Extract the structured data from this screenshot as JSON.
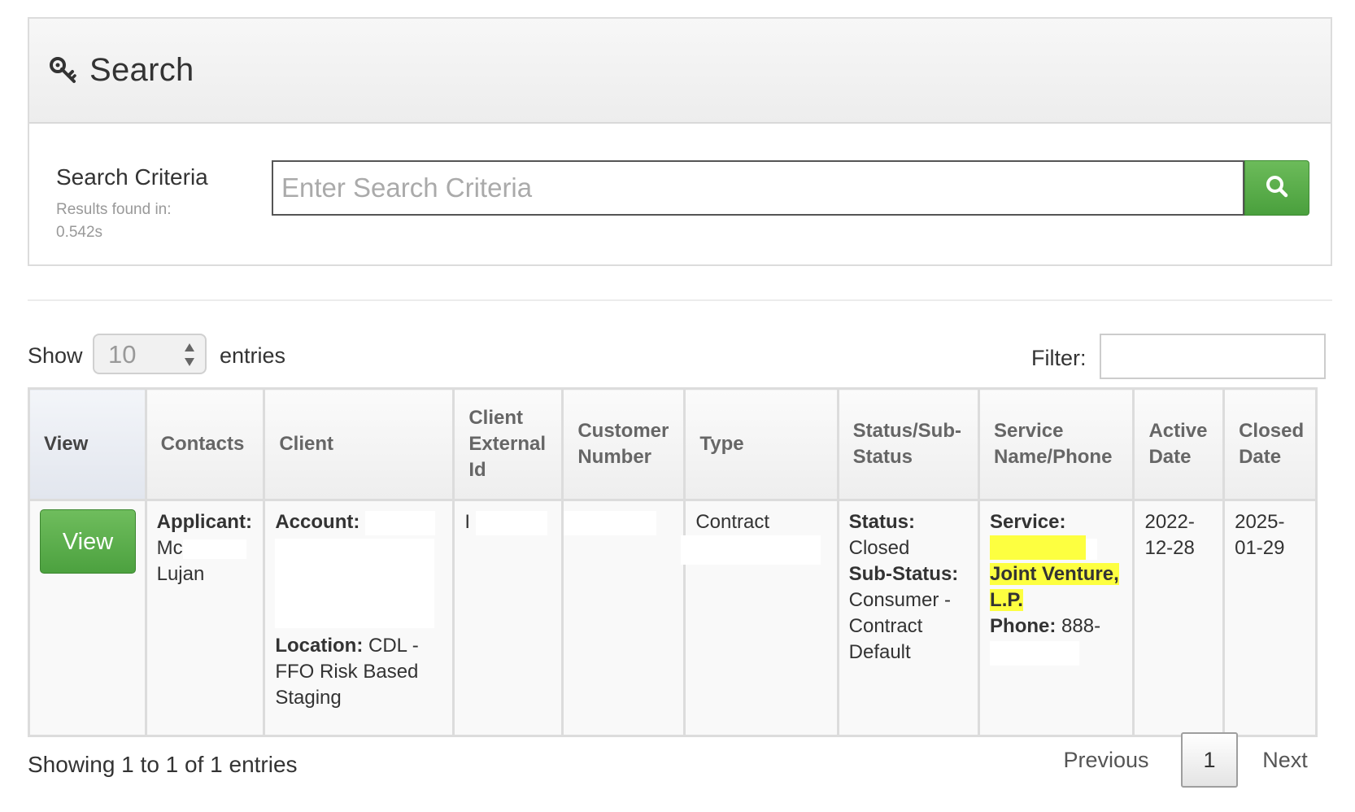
{
  "search_panel": {
    "title": "Search",
    "criteria_label": "Search Criteria",
    "results_text": "Results found in: 0.542s",
    "input_value": "",
    "input_placeholder": "Enter Search Criteria",
    "icons": {
      "title_icon": "key-icon",
      "submit_icon": "search-icon"
    }
  },
  "length_control": {
    "show_label": "Show",
    "value": "10",
    "entries_label": "entries"
  },
  "filter": {
    "label": "Filter:",
    "value": ""
  },
  "table": {
    "columns": [
      "View",
      "Contacts",
      "Client",
      "Client External Id",
      "Customer Number",
      "Type",
      "Status/Sub-Status",
      "Service Name/Phone",
      "Active Date",
      "Closed Date"
    ],
    "rows": [
      {
        "view_label": "View",
        "contacts": {
          "applicant_label": "Applicant:",
          "applicant_name_start": "Mc",
          "applicant_name_end": "Lujan"
        },
        "client": {
          "account_label": "Account:",
          "location_label": "Location:",
          "location_value": "CDL - FFO Risk Based Staging"
        },
        "client_external_id": "I",
        "customer_number": "",
        "type": "Contract",
        "status": {
          "status_label": "Status:",
          "status_value": "Closed",
          "sub_status_label": "Sub-Status:",
          "sub_status_value": "Consumer - Contract Default"
        },
        "service": {
          "service_label": "Service:",
          "service_name_visible": "Joint Venture, L.P.",
          "phone_label": "Phone:",
          "phone_value": "888-"
        },
        "active_date": "2022-12-28",
        "closed_date": "2025-01-29"
      }
    ]
  },
  "footer": {
    "info": "Showing 1 to 1 of 1 entries",
    "previous": "Previous",
    "current_page": "1",
    "next": "Next"
  },
  "colors": {
    "accent_green": "#5cb04c",
    "highlight_yellow": "#fdff40",
    "panel_border": "#dcdcdc"
  }
}
